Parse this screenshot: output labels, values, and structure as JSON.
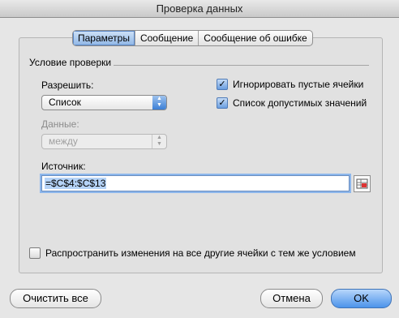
{
  "window": {
    "title": "Проверка данных"
  },
  "tabs": [
    {
      "label": "Параметры",
      "active": true
    },
    {
      "label": "Сообщение",
      "active": false
    },
    {
      "label": "Сообщение об ошибке",
      "active": false
    }
  ],
  "criteria": {
    "section_title": "Условие проверки",
    "allow_label": "Разрешить:",
    "allow_value": "Список",
    "data_label": "Данные:",
    "data_value": "между",
    "ignore_blank": {
      "label": "Игнорировать пустые ячейки",
      "checked": true
    },
    "in_cell_dropdown": {
      "label": "Список допустимых значений",
      "checked": true
    },
    "source_label": "Источник:",
    "source_value": "=$C$4:$C$13"
  },
  "apply_all": {
    "label": "Распространить изменения на все другие ячейки с тем же условием",
    "checked": false
  },
  "buttons": {
    "clear_all": "Очистить все",
    "cancel": "Отмена",
    "ok": "OK"
  },
  "colors": {
    "accent": "#4c93ea",
    "selection": "#b5d3f7"
  }
}
